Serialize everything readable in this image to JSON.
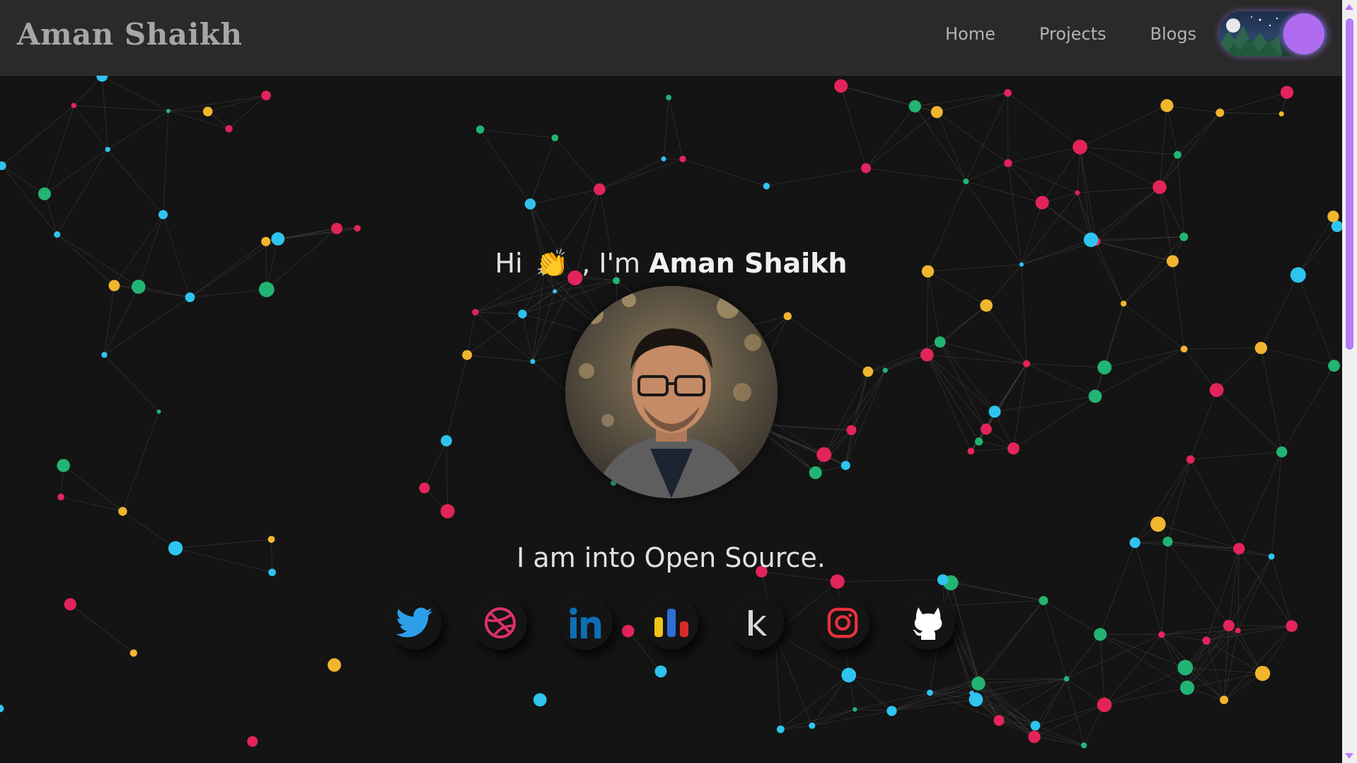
{
  "navbar": {
    "brand": "Aman Shaikh",
    "links": [
      "Home",
      "Projects",
      "Blogs"
    ],
    "theme_toggle": "dark-mode-toggle"
  },
  "hero": {
    "greeting_prefix": "Hi",
    "greeting_wave": "👏",
    "greeting_mid": ", I'm",
    "name": "Aman Shaikh",
    "tagline": "I am into Open Source."
  },
  "socials": [
    {
      "name": "twitter-icon",
      "color": "#2d9fea"
    },
    {
      "name": "dribbble-icon",
      "color": "#e0306e"
    },
    {
      "name": "linkedin-icon",
      "color": "#0c6fb5"
    },
    {
      "name": "stackshare-icon",
      "color": "#f2c418"
    },
    {
      "name": "kaggle-icon",
      "color": "#d8d8d8"
    },
    {
      "name": "instagram-icon",
      "color": "#e8313f"
    },
    {
      "name": "github-icon",
      "color": "#ffffff"
    }
  ],
  "colors": {
    "background": "#141414",
    "navbar": "#2a2a2a",
    "accent": "#b06cf0",
    "node_colors": [
      "#2ec4ef",
      "#f1b62e",
      "#e3245a",
      "#22b473"
    ]
  }
}
